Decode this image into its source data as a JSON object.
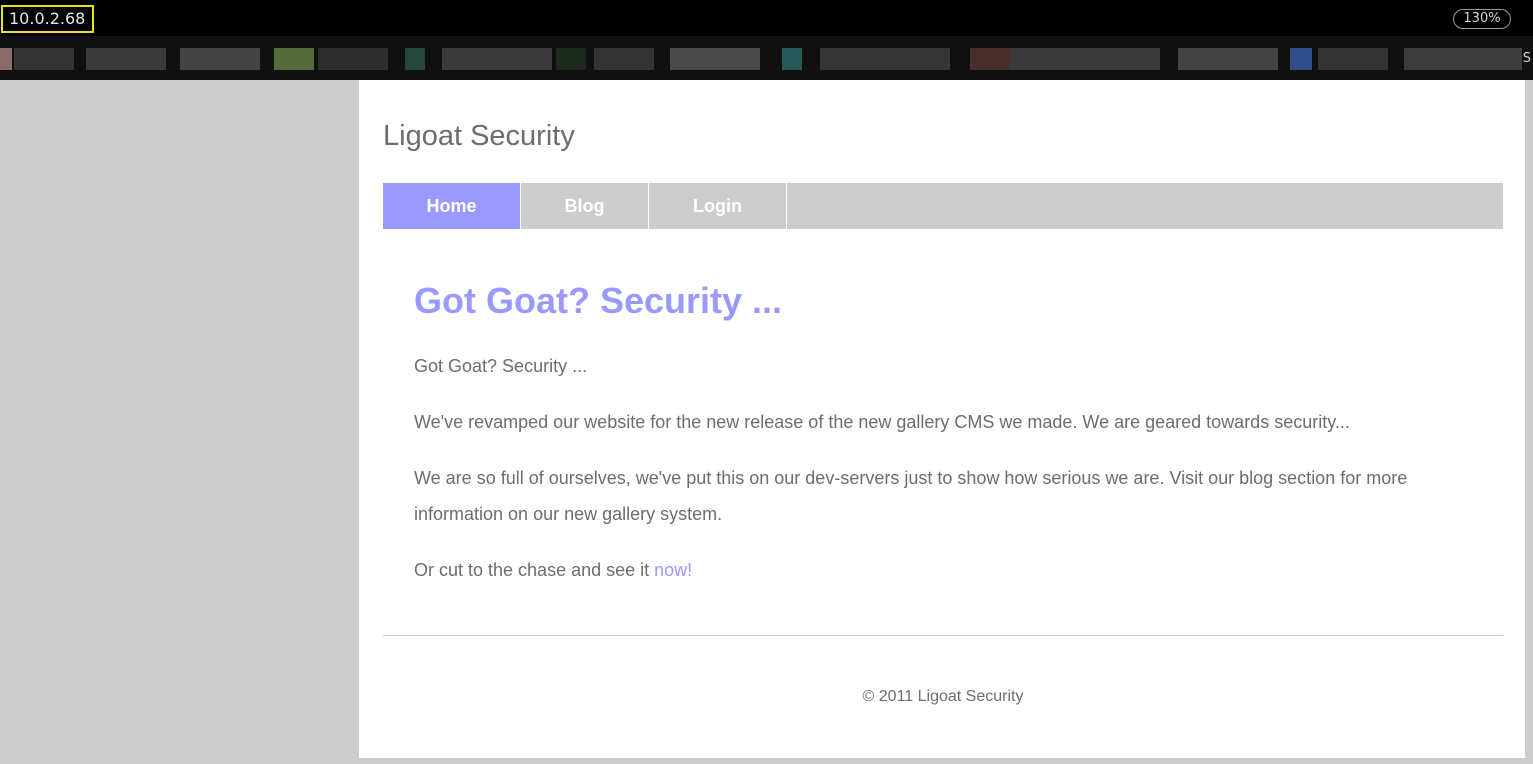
{
  "browser": {
    "address": "10.0.2.68",
    "zoom": "130%",
    "bookmarks_tail": "S"
  },
  "site": {
    "title": "Ligoat Security"
  },
  "nav": {
    "items": [
      {
        "label": "Home",
        "active": true
      },
      {
        "label": "Blog",
        "active": false
      },
      {
        "label": "Login",
        "active": false
      }
    ]
  },
  "main": {
    "heading": "Got Goat? Security ...",
    "intro": "Got Goat? Security ...",
    "p1": "We've revamped our website for the new release of the new gallery CMS we made. We are geared towards security...",
    "p2": "We are so full of ourselves, we've put this on our dev-servers just to show how serious we are. Visit our blog section for more information on our new gallery system.",
    "p3_prefix": "Or cut to the chase and see it ",
    "p3_link": "now!"
  },
  "footer": {
    "text": "© 2011 Ligoat Security"
  },
  "colors": {
    "accent": "#9999ff",
    "nav_bg": "#cccccc",
    "text": "#6d6d6d",
    "address_highlight": "#e7e21c"
  }
}
